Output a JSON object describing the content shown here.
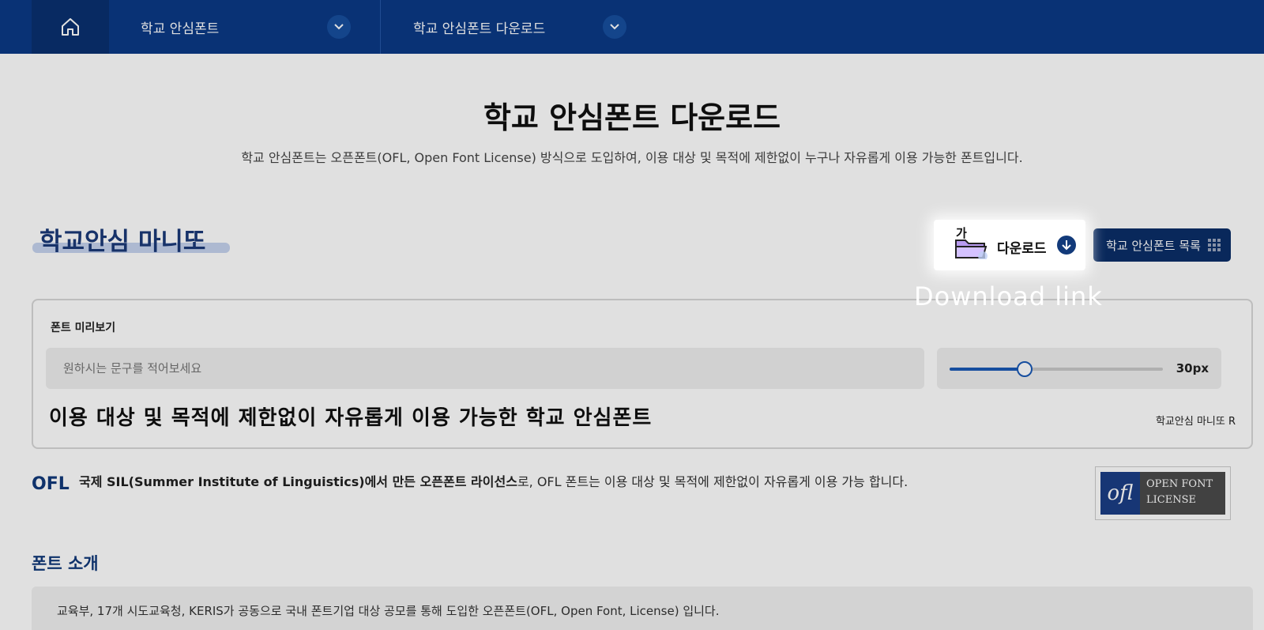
{
  "nav": {
    "home_icon": "home-icon",
    "item1": "학교 안심폰트",
    "item2": "학교 안심폰트 다운로드"
  },
  "header": {
    "title": "학교 안심폰트 다운로드",
    "subtitle": "학교 안심폰트는 오픈폰트(OFL, Open Font License) 방식으로 도입하여, 이용 대상 및 목적에 제한없이 누구나 자유롭게 이용 가능한 폰트입니다."
  },
  "font": {
    "name": "학교안심 마니또"
  },
  "download": {
    "icon_letter": "가",
    "label": "다운로드",
    "annotation": "Download link"
  },
  "list_button": {
    "label": "학교 안심폰트 목록"
  },
  "preview": {
    "label": "폰트 미리보기",
    "placeholder": "원하시는 문구를 적어보세요",
    "size_value": "30px",
    "size_fraction": 0.35,
    "sample_text": "이용 대상 및 목적에 제한없이 자유롭게 이용 가능한 학교 안심폰트",
    "font_label": "학교안심 마니또 R"
  },
  "ofl": {
    "tag": "OFL",
    "text_bold": "국제 SIL(Summer Institute of Linguistics)에서 만든 오픈폰트 라이선스",
    "text_rest": "로, OFL 폰트는 이용 대상 및 목적에 제한없이 자유롭게 이용 가능 합니다.",
    "badge_logo": "ofl",
    "badge_line1": "OPEN FONT",
    "badge_line2": "LICENSE"
  },
  "intro": {
    "title": "폰트 소개",
    "line1": "교육부, 17개 시도교육청, KERIS가 공동으로 국내 폰트기업 대상 공모를 통해 도입한 오픈폰트(OFL, Open Font, License) 입니다."
  },
  "colors": {
    "nav_bg": "#0b3a86",
    "accent": "#1a59b5",
    "dark_btn": "#0b2e68"
  }
}
